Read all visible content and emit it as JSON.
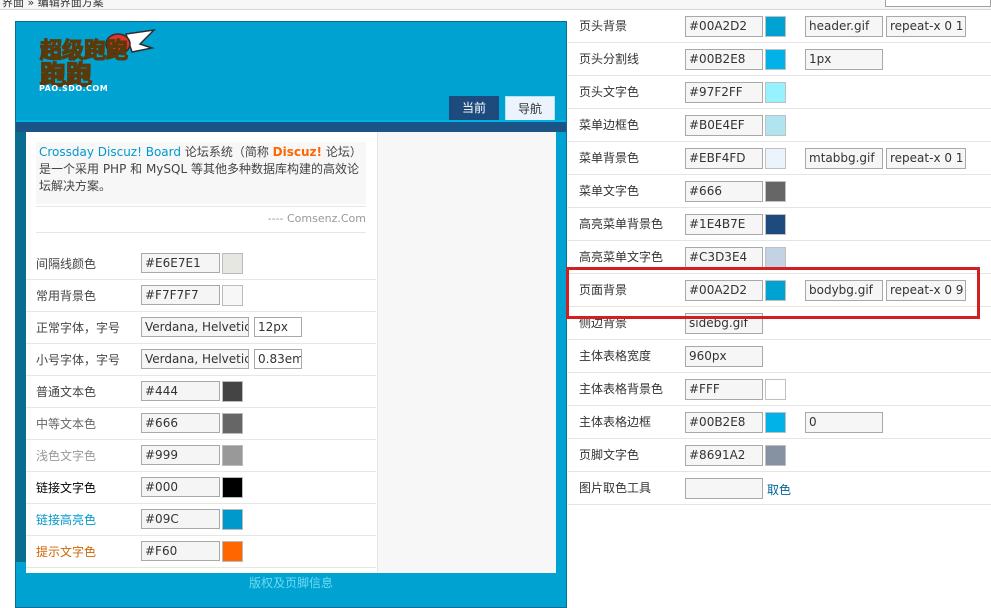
{
  "breadcrumb": {
    "text": "界面 » 编辑界面方案"
  },
  "preview": {
    "logo_text": "超级跑跑",
    "logo_sub": "PAO.SDO.COM",
    "tabs": [
      {
        "label": "当前"
      },
      {
        "label": "导航"
      }
    ],
    "intro": {
      "part1": "Crossday Discuz! Board",
      "part2": " 论坛系统（简称 ",
      "part3": "Discuz!",
      "part4": " 论坛）是一个采用 PHP 和 MySQL 等其他多种数据库构建的高效论坛解决方案。"
    },
    "signature": "---- Comsenz.Com",
    "rows": [
      {
        "label": "间隔线颜色",
        "value": "#E6E7E1",
        "color": "#E6E7E1",
        "label_color": "#444"
      },
      {
        "label": "常用背景色",
        "value": "#F7F7F7",
        "color": "#F7F7F7",
        "label_color": "#444"
      },
      {
        "label": "正常字体，字号",
        "value": "Verdana, Helvetica",
        "extra": "12px",
        "label_color": "#444"
      },
      {
        "label": "小号字体，字号",
        "value": "Verdana, Helvetica",
        "extra": "0.83em",
        "label_color": "#444"
      },
      {
        "label": "普通文本色",
        "value": "#444",
        "color": "#444444",
        "label_color": "#444"
      },
      {
        "label": "中等文本色",
        "value": "#666",
        "color": "#666666",
        "label_color": "#666"
      },
      {
        "label": "浅色文字色",
        "value": "#999",
        "color": "#999999",
        "label_color": "#999"
      },
      {
        "label": "链接文字色",
        "value": "#000",
        "color": "#000000",
        "label_color": "#000"
      },
      {
        "label": "链接高亮色",
        "value": "#09C",
        "color": "#0099CC",
        "label_color": "#09C"
      },
      {
        "label": "提示文字色",
        "value": "#F60",
        "color": "#FF6600",
        "label_color": "#C60"
      }
    ],
    "footer": "版权及页脚信息"
  },
  "settings": {
    "rows": [
      {
        "label": "页头背景",
        "value": "#00A2D2",
        "color": "#00A2D2",
        "image": "header.gif",
        "repeat": "repeat-x 0 1"
      },
      {
        "label": "页头分割线",
        "value": "#00B2E8",
        "color": "#00B2E8",
        "extra": "1px"
      },
      {
        "label": "页头文字色",
        "value": "#97F2FF",
        "color": "#97F2FF"
      },
      {
        "label": "菜单边框色",
        "value": "#B0E4EF",
        "color": "#B0E4EF"
      },
      {
        "label": "菜单背景色",
        "value": "#EBF4FD",
        "color": "#EBF4FD",
        "image": "mtabbg.gif",
        "repeat": "repeat-x 0 1"
      },
      {
        "label": "菜单文字色",
        "value": "#666",
        "color": "#666666"
      },
      {
        "label": "高亮菜单背景色",
        "value": "#1E4B7E",
        "color": "#1E4B7E"
      },
      {
        "label": "高亮菜单文字色",
        "value": "#C3D3E4",
        "color": "#C3D3E4"
      },
      {
        "label": "页面背景",
        "value": "#00A2D2",
        "color": "#00A2D2",
        "image": "bodybg.gif",
        "repeat": "repeat-x 0 9"
      },
      {
        "label": "侧边背景",
        "value": "sidebg.gif"
      },
      {
        "label": "主体表格宽度",
        "value": "960px"
      },
      {
        "label": "主体表格背景色",
        "value": "#FFF",
        "color": "#FFFFFF"
      },
      {
        "label": "主体表格边框",
        "value": "#00B2E8",
        "color": "#00B2E8",
        "extra": "0"
      },
      {
        "label": "页脚文字色",
        "value": "#8691A2",
        "color": "#8691A2"
      },
      {
        "label": "图片取色工具",
        "value": "",
        "link": "取色"
      }
    ]
  }
}
